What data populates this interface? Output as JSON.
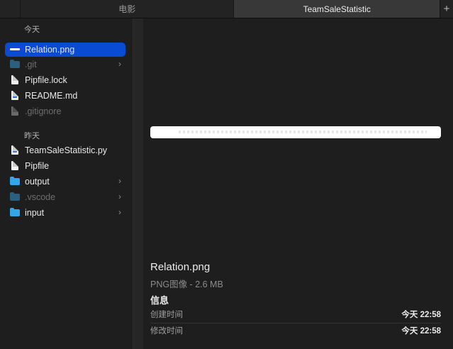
{
  "tabs": {
    "movies_label": "电影",
    "active_label": "TeamSaleStatistic",
    "add_label": "+"
  },
  "file_list": {
    "today_header": "今天",
    "yesterday_header": "昨天",
    "today_items": [
      {
        "name": "Relation.png",
        "icon": "png-image-icon",
        "selected": true,
        "dim": false,
        "folder": false
      },
      {
        "name": ".git",
        "icon": "folder-icon",
        "selected": false,
        "dim": true,
        "folder": true
      },
      {
        "name": "Pipfile.lock",
        "icon": "document-icon",
        "selected": false,
        "dim": false,
        "folder": false
      },
      {
        "name": "README.md",
        "icon": "markdown-document-icon",
        "selected": false,
        "dim": false,
        "folder": false
      },
      {
        "name": ".gitignore",
        "icon": "document-icon",
        "selected": false,
        "dim": true,
        "folder": false
      }
    ],
    "yesterday_items": [
      {
        "name": "TeamSaleStatistic.py",
        "icon": "python-document-icon",
        "selected": false,
        "dim": false,
        "folder": false
      },
      {
        "name": "Pipfile",
        "icon": "document-icon",
        "selected": false,
        "dim": false,
        "folder": false
      },
      {
        "name": "output",
        "icon": "folder-icon",
        "selected": false,
        "dim": false,
        "folder": true
      },
      {
        "name": ".vscode",
        "icon": "folder-icon",
        "selected": false,
        "dim": true,
        "folder": true
      },
      {
        "name": "input",
        "icon": "folder-icon",
        "selected": false,
        "dim": false,
        "folder": true
      }
    ],
    "chevron": "›"
  },
  "preview": {
    "file_name": "Relation.png",
    "file_kind": "PNG图像 - 2.6 MB",
    "info_header": "信息",
    "created_label": "创建时间",
    "created_value": "今天 22:58",
    "modified_label": "修改时间",
    "modified_value": "今天 22:58"
  },
  "colors": {
    "selection": "#0a4bd4",
    "folder": "#33a6e8",
    "background": "#1e1e1e"
  }
}
